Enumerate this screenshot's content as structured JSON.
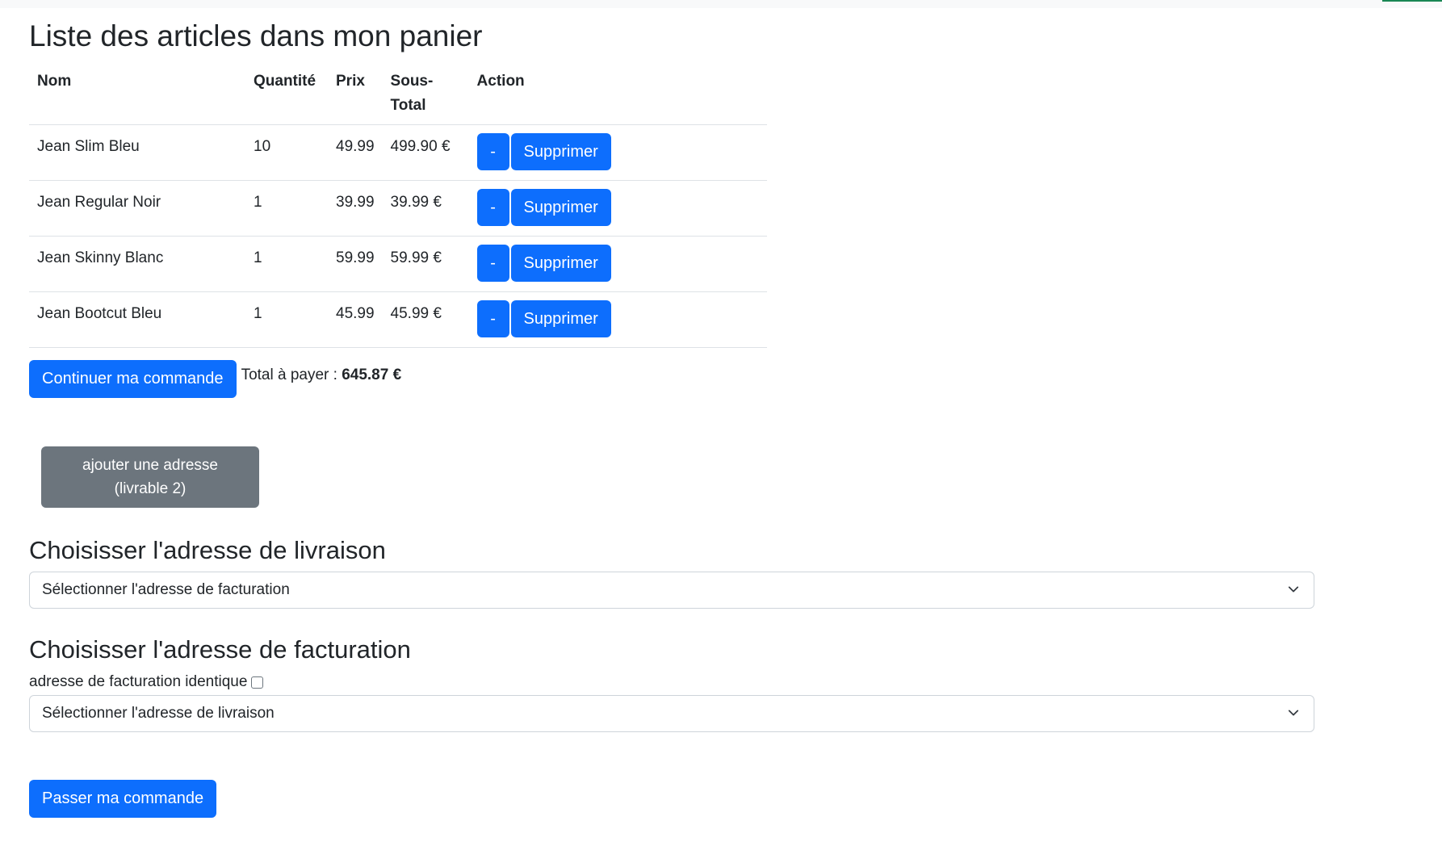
{
  "page": {
    "title": "Liste des articles dans mon panier"
  },
  "cart": {
    "headers": {
      "name": "Nom",
      "quantity": "Quantité",
      "price": "Prix",
      "subtotal": "Sous-Total",
      "action": "Action"
    },
    "items": [
      {
        "name": "Jean Slim Bleu",
        "quantity": "10",
        "price": "49.99",
        "subtotal": "499.90 €",
        "minus_label": "-",
        "delete_label": "Supprimer"
      },
      {
        "name": "Jean Regular Noir",
        "quantity": "1",
        "price": "39.99",
        "subtotal": "39.99 €",
        "minus_label": "-",
        "delete_label": "Supprimer"
      },
      {
        "name": "Jean Skinny Blanc",
        "quantity": "1",
        "price": "59.99",
        "subtotal": "59.99 €",
        "minus_label": "-",
        "delete_label": "Supprimer"
      },
      {
        "name": "Jean Bootcut Bleu",
        "quantity": "1",
        "price": "45.99",
        "subtotal": "45.99 €",
        "minus_label": "-",
        "delete_label": "Supprimer"
      }
    ],
    "continue_label": "Continuer ma commande",
    "total_label": "Total à payer : ",
    "total_value": "645.87 €"
  },
  "address": {
    "add_button_line1": "ajouter une adresse",
    "add_button_line2": "(livrable 2)",
    "delivery_heading": "Choisisser l'adresse de livraison",
    "delivery_select_value": "Sélectionner l'adresse de facturation",
    "billing_heading": "Choisisser l'adresse de facturation",
    "same_billing_label": "adresse de facturation identique",
    "same_billing_checked": false,
    "billing_select_value": "Sélectionner l'adresse de livraison"
  },
  "order": {
    "submit_label": "Passer ma commande"
  },
  "colors": {
    "primary": "#0d6efd",
    "secondary": "#6c757d",
    "text": "#212529",
    "border": "#dee2e6"
  },
  "icons": {
    "select_chevron": "chevron-down-icon"
  }
}
